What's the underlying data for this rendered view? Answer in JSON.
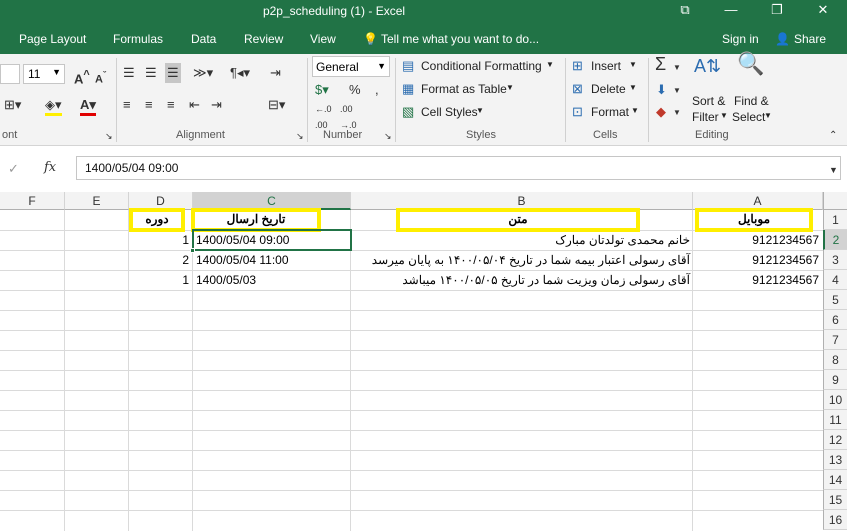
{
  "window": {
    "title": "p2p_scheduling (1) - Excel",
    "controls": [
      "⧉",
      "—",
      "❐",
      "✕"
    ]
  },
  "tabs": [
    "Page Layout",
    "Formulas",
    "Data",
    "Review",
    "View"
  ],
  "tell_me": "Tell me what you want to do...",
  "account": {
    "signin": "Sign in",
    "share": "Share"
  },
  "ribbon": {
    "font_size": "11",
    "number_format": "General",
    "conditional_formatting": "Conditional Formatting",
    "format_as_table": "Format as Table",
    "cell_styles": "Cell Styles",
    "insert": "Insert",
    "delete": "Delete",
    "format": "Format",
    "sort_filter_1": "Sort &",
    "sort_filter_2": "Filter",
    "find_select_1": "Find &",
    "find_select_2": "Select",
    "groups": {
      "font": "ont",
      "alignment": "Alignment",
      "number": "Number",
      "styles": "Styles",
      "cells": "Cells",
      "editing": "Editing"
    }
  },
  "formula_bar": {
    "fx": "fx",
    "value": "1400/05/04  09:00"
  },
  "columns": [
    "F",
    "E",
    "D",
    "C",
    "B",
    "A"
  ],
  "rows": [
    "1",
    "2",
    "3",
    "4",
    "5",
    "6",
    "7",
    "8",
    "9",
    "10",
    "11",
    "12",
    "13",
    "14",
    "15",
    "16"
  ],
  "headers": {
    "mobile": "موبایل",
    "text": "متن",
    "send_date": "تاریخ ارسال",
    "period": "دوره"
  },
  "data_rows": [
    {
      "mobile": "9121234567",
      "text": "خانم محمدی تولدتان مبارک",
      "send_date": "1400/05/04   09:00",
      "period": "1"
    },
    {
      "mobile": "9121234567",
      "text": "آقای رسولی اعتبار بیمه شما در تاریخ ۱۴۰۰/۰۵/۰۴ به پایان میرسد",
      "send_date": "1400/05/04  11:00",
      "period": "2"
    },
    {
      "mobile": "9121234567",
      "text": "آقای رسولی زمان ویزیت شما در تاریخ ۱۴۰۰/۰۵/۰۵ میباشد",
      "send_date": "1400/05/03",
      "period": "1"
    }
  ],
  "colors": {
    "excel_green": "#217346",
    "highlight_yellow": "#ffef00"
  }
}
